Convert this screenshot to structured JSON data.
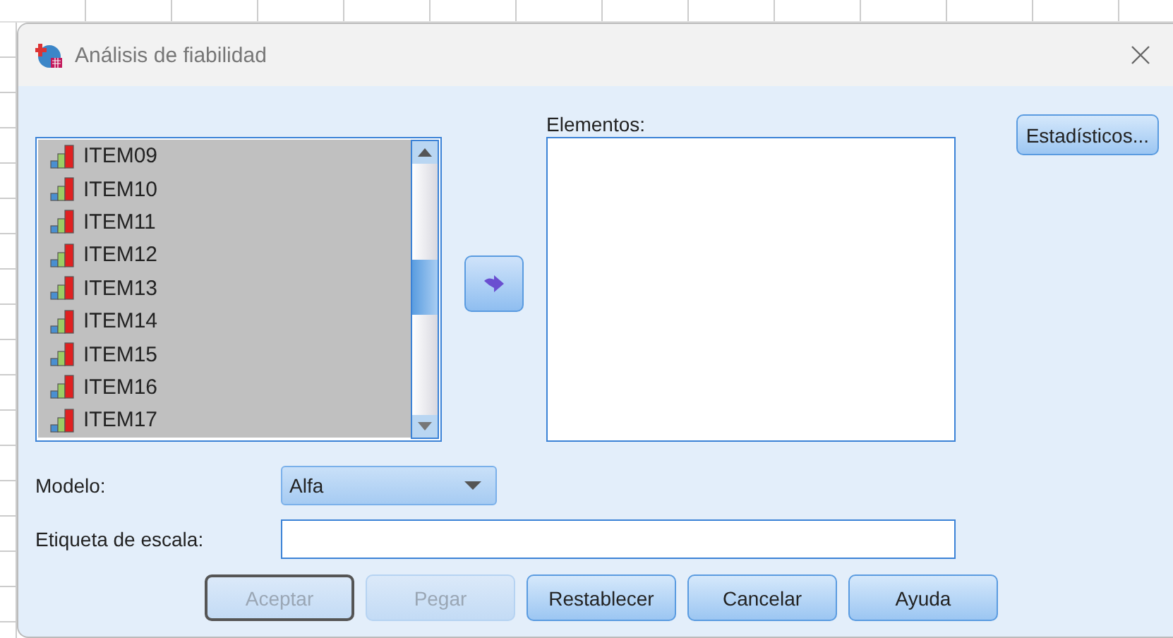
{
  "window": {
    "title": "Análisis de fiabilidad"
  },
  "variables": [
    {
      "name": "ITEM09",
      "selected": true
    },
    {
      "name": "ITEM10",
      "selected": true
    },
    {
      "name": "ITEM11",
      "selected": true
    },
    {
      "name": "ITEM12",
      "selected": true
    },
    {
      "name": "ITEM13",
      "selected": true
    },
    {
      "name": "ITEM14",
      "selected": true
    },
    {
      "name": "ITEM15",
      "selected": true
    },
    {
      "name": "ITEM16",
      "selected": true
    },
    {
      "name": "ITEM17",
      "selected": true
    }
  ],
  "elements": {
    "label": "Elementos:"
  },
  "statistics_button": "Estadísticos...",
  "model": {
    "label": "Modelo:",
    "value": "Alfa"
  },
  "scale_label": {
    "label": "Etiqueta de escala:"
  },
  "buttons": [
    {
      "label": "Aceptar",
      "disabled": true,
      "default": true
    },
    {
      "label": "Pegar",
      "disabled": true,
      "default": false
    },
    {
      "label": "Restablecer",
      "disabled": false,
      "default": false
    },
    {
      "label": "Cancelar",
      "disabled": false,
      "default": false
    },
    {
      "label": "Ayuda",
      "disabled": false,
      "default": false
    }
  ]
}
